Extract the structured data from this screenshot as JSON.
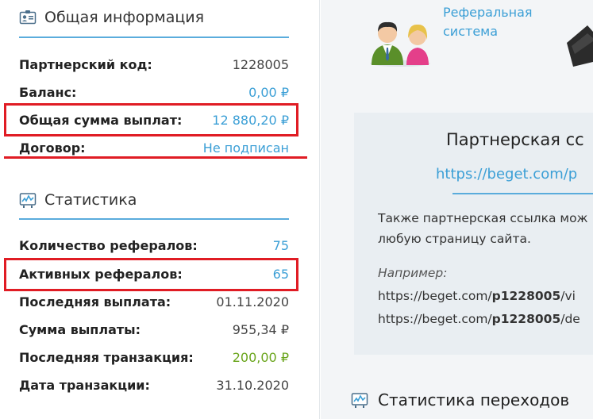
{
  "general": {
    "title": "Общая информация",
    "rows": [
      {
        "label": "Партнерский код:",
        "value": "1228005"
      },
      {
        "label": "Баланс:",
        "value": "0,00 ₽"
      },
      {
        "label": "Общая сумма выплат:",
        "value": "12 880,20 ₽"
      },
      {
        "label": "Договор:",
        "value": "Не подписан"
      }
    ]
  },
  "stats": {
    "title": "Статистика",
    "rows": [
      {
        "label": "Количество рефералов:",
        "value": "75"
      },
      {
        "label": "Активных рефералов:",
        "value": "65"
      },
      {
        "label": "Последняя выплата:",
        "value": "01.11.2020"
      },
      {
        "label": "Сумма выплаты:",
        "value": "955,34 ₽"
      },
      {
        "label": "Последняя транзакция:",
        "value": "200,00 ₽"
      },
      {
        "label": "Дата транзакции:",
        "value": "31.10.2020"
      }
    ]
  },
  "main": {
    "referral_link_line1": "Реферальная",
    "referral_link_line2": "система",
    "panel_title": "Партнерская сс",
    "panel_url": "https://beget.com/p",
    "panel_text_line1": "Также партнерская ссылка мож",
    "panel_text_line2": "любую страницу сайта.",
    "example_label": "Например:",
    "example1_prefix": "https://beget.com/",
    "example1_code": "p1228005",
    "example1_suffix": "/vi",
    "example2_prefix": "https://beget.com/",
    "example2_code": "p1228005",
    "example2_suffix": "/de",
    "transitions_title": "Статистика переходов"
  },
  "colors": {
    "accent": "#3b9fd6",
    "highlight": "#e01c24",
    "positive": "#6aa51c"
  },
  "icons": [
    "id-card-icon",
    "stats-chart-icon",
    "people-icon",
    "wallet-icon"
  ]
}
